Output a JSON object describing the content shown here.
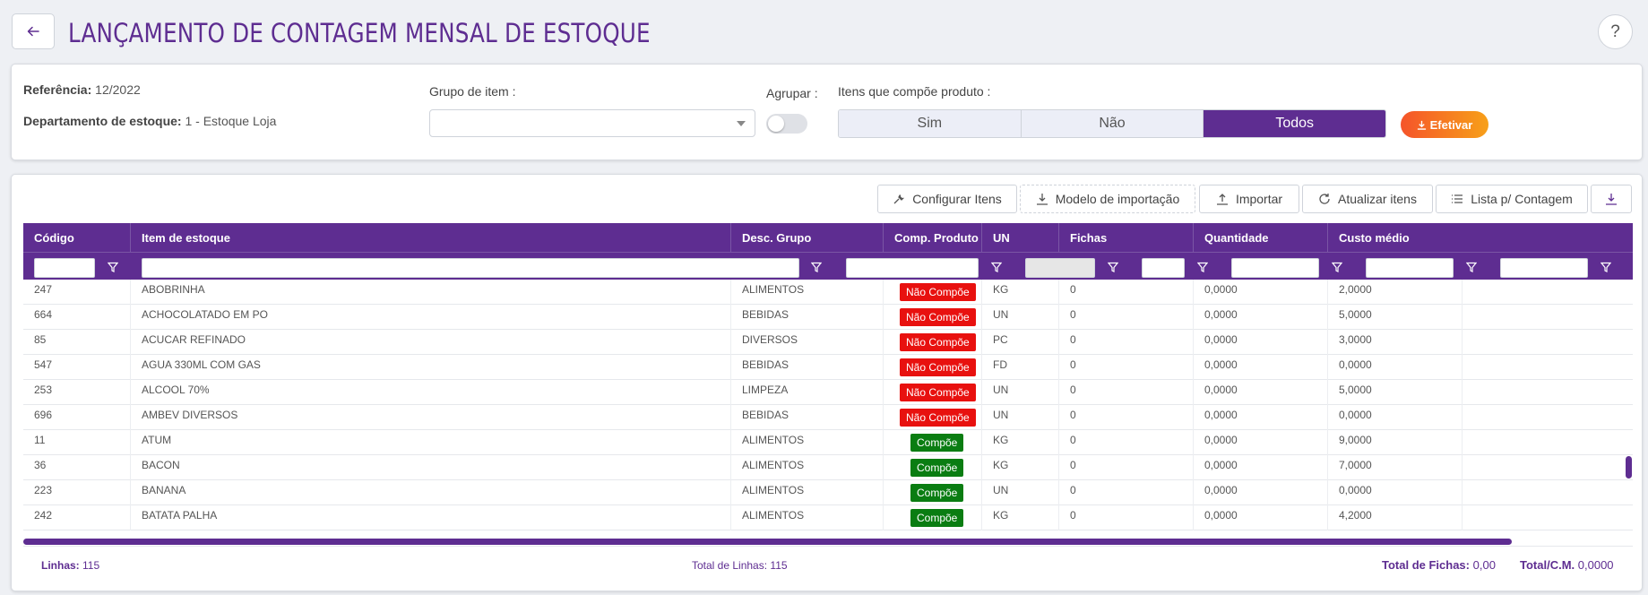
{
  "header": {
    "title": "LANÇAMENTO DE CONTAGEM MENSAL DE ESTOQUE",
    "back_icon": "arrow-left-icon",
    "help_label": "?"
  },
  "filters": {
    "reference_label": "Referência:",
    "reference_value": "12/2022",
    "department_label": "Departamento de estoque:",
    "department_value": "1 - Estoque Loja",
    "group_label": "Grupo de item :",
    "group_value": "",
    "group_by_label": "Agrupar :",
    "group_by_on": false,
    "compose_label": "Itens que compõe produto :",
    "compose_options": [
      "Sim",
      "Não",
      "Todos"
    ],
    "compose_selected": "Todos",
    "efetivar_label": "Efetivar"
  },
  "toolbar": {
    "configure": "Configurar Itens",
    "import_model": "Modelo de importação",
    "import": "Importar",
    "refresh": "Atualizar itens",
    "count_list": "Lista p/ Contagem"
  },
  "table": {
    "columns": [
      "Código",
      "Item de estoque",
      "Desc. Grupo",
      "Comp. Produto",
      "UN",
      "Fichas",
      "Quantidade",
      "Custo médio"
    ],
    "rows": [
      {
        "code": "247",
        "item": "ABOBRINHA",
        "group": "ALIMENTOS",
        "comp": "Não Compõe",
        "un": "KG",
        "fichas": "0",
        "qty": "0,0000",
        "cost": "2,0000"
      },
      {
        "code": "664",
        "item": "ACHOCOLATADO EM PO",
        "group": "BEBIDAS",
        "comp": "Não Compõe",
        "un": "UN",
        "fichas": "0",
        "qty": "0,0000",
        "cost": "5,0000"
      },
      {
        "code": "85",
        "item": "ACUCAR REFINADO",
        "group": "DIVERSOS",
        "comp": "Não Compõe",
        "un": "PC",
        "fichas": "0",
        "qty": "0,0000",
        "cost": "3,0000"
      },
      {
        "code": "547",
        "item": "AGUA 330ML COM GAS",
        "group": "BEBIDAS",
        "comp": "Não Compõe",
        "un": "FD",
        "fichas": "0",
        "qty": "0,0000",
        "cost": "0,0000"
      },
      {
        "code": "253",
        "item": "ALCOOL 70%",
        "group": "LIMPEZA",
        "comp": "Não Compõe",
        "un": "UN",
        "fichas": "0",
        "qty": "0,0000",
        "cost": "5,0000"
      },
      {
        "code": "696",
        "item": "AMBEV DIVERSOS",
        "group": "BEBIDAS",
        "comp": "Não Compõe",
        "un": "UN",
        "fichas": "0",
        "qty": "0,0000",
        "cost": "0,0000"
      },
      {
        "code": "11",
        "item": "ATUM",
        "group": "ALIMENTOS",
        "comp": "Compõe",
        "un": "KG",
        "fichas": "0",
        "qty": "0,0000",
        "cost": "9,0000"
      },
      {
        "code": "36",
        "item": "BACON",
        "group": "ALIMENTOS",
        "comp": "Compõe",
        "un": "KG",
        "fichas": "0",
        "qty": "0,0000",
        "cost": "7,0000"
      },
      {
        "code": "223",
        "item": "BANANA",
        "group": "ALIMENTOS",
        "comp": "Compõe",
        "un": "UN",
        "fichas": "0",
        "qty": "0,0000",
        "cost": "0,0000"
      },
      {
        "code": "242",
        "item": "BATATA PALHA",
        "group": "ALIMENTOS",
        "comp": "Compõe",
        "un": "KG",
        "fichas": "0",
        "qty": "0,0000",
        "cost": "4,2000"
      }
    ]
  },
  "footer": {
    "lines_label": "Linhas:",
    "lines_value": "115",
    "total_lines_label": "Total de Linhas:",
    "total_lines_value": "115",
    "total_fichas_label": "Total de Fichas:",
    "total_fichas_value": "0,00",
    "total_cm_label": "Total/C.M.",
    "total_cm_value": "0,0000"
  },
  "colors": {
    "brand": "#5e2d91",
    "badge_no": "#e8110f",
    "badge_yes": "#0a7d12",
    "efetivar_from": "#f5542a",
    "efetivar_to": "#f7a019"
  }
}
